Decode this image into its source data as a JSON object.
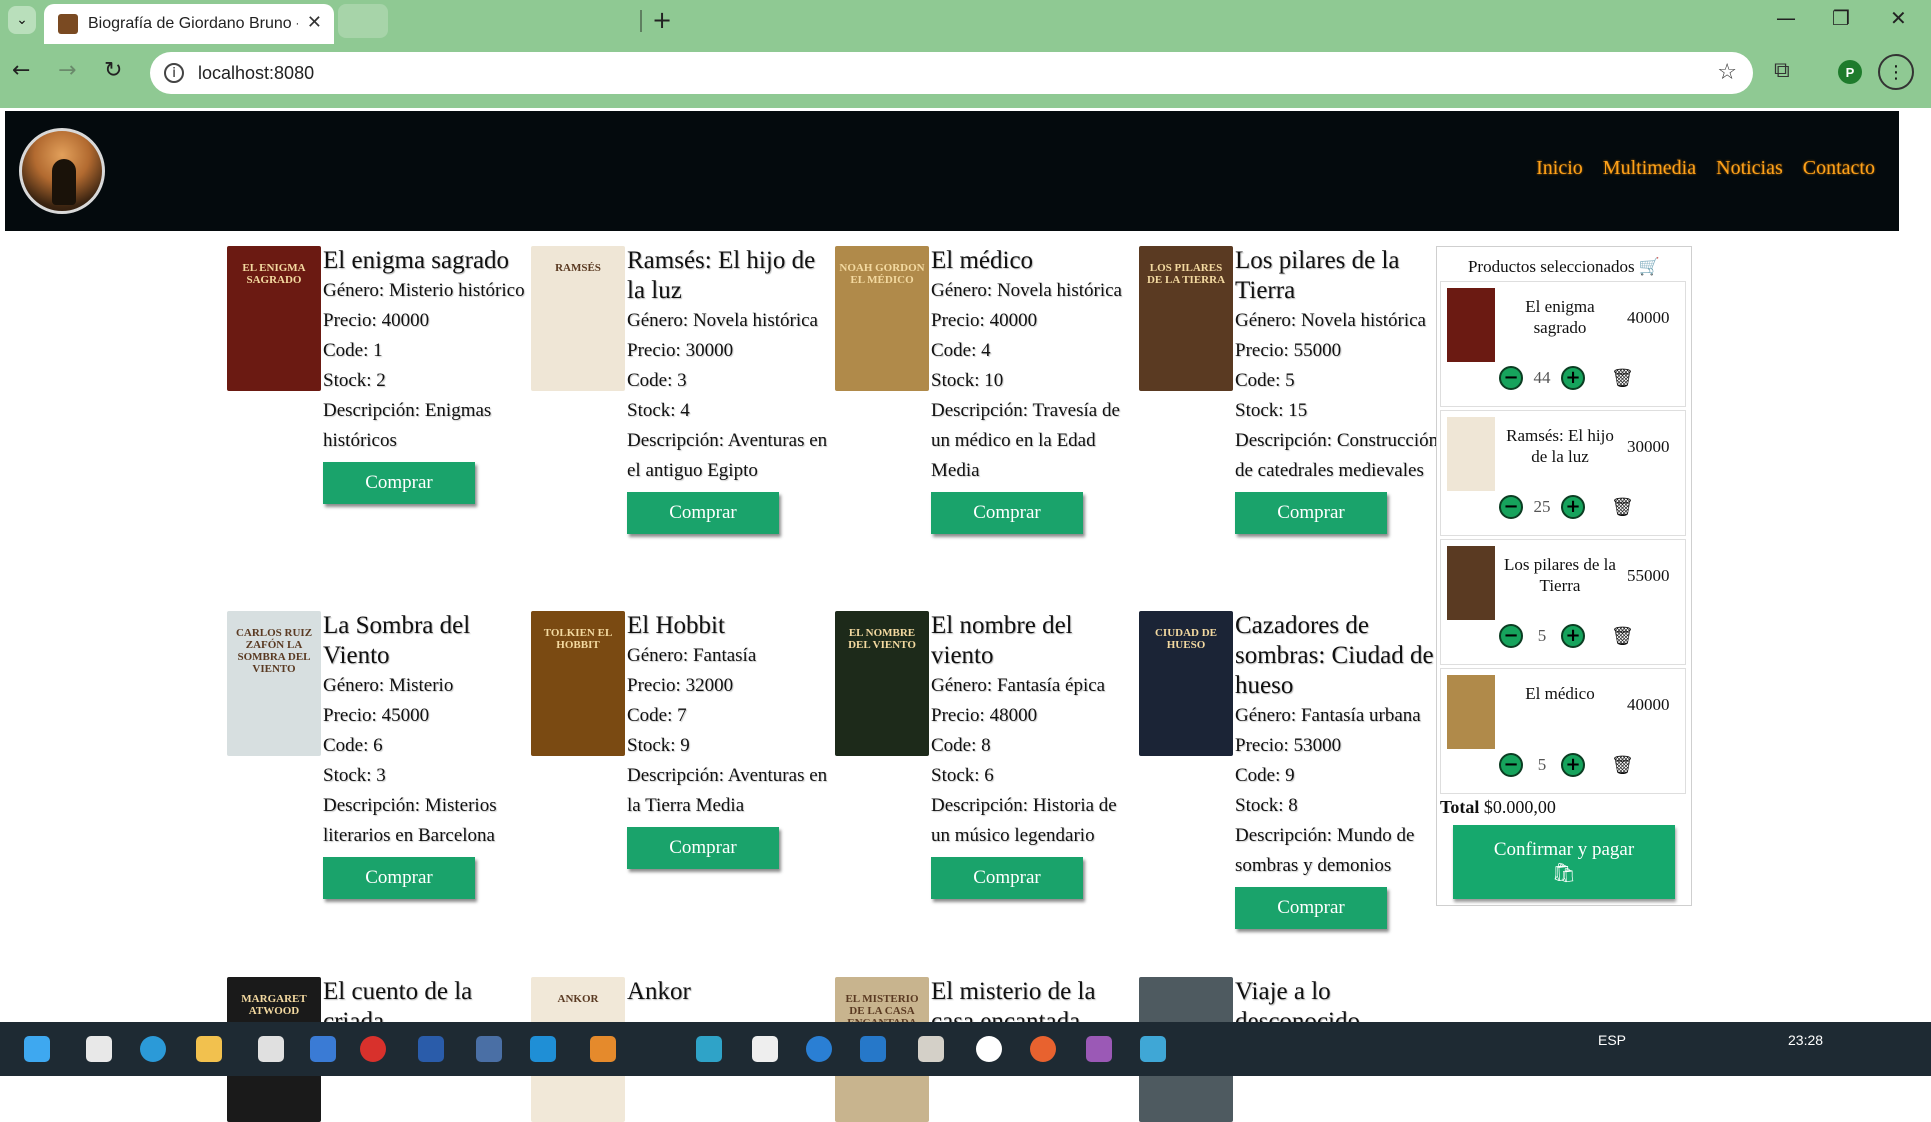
{
  "browser": {
    "tab_title": "Biografía de Giordano Bruno - V",
    "url": "localhost:8080",
    "profile_initial": "P"
  },
  "nav": [
    "Inicio",
    "Multimedia",
    "Noticias",
    "Contacto"
  ],
  "labels": {
    "genre": "Género: ",
    "price": "Precio: ",
    "code": "Code: ",
    "stock": "Stock: ",
    "desc": "Descripción: ",
    "buy": "Comprar"
  },
  "products": [
    {
      "name": "El enigma sagrado",
      "genre": "Misterio histórico",
      "price": "40000",
      "code": "1",
      "stock": "2",
      "desc": "Enigmas históricos",
      "cover_color": "#6b1a12",
      "cover_text": "EL ENIGMA SAGRADO"
    },
    {
      "name": "Ramsés: El hijo de la luz",
      "genre": "Novela histórica",
      "price": "30000",
      "code": "3",
      "stock": "4",
      "desc": "Aventuras en el antiguo Egipto",
      "cover_color": "#efe6d6",
      "cover_text": "RAMSÉS"
    },
    {
      "name": "El médico",
      "genre": "Novela histórica",
      "price": "40000",
      "code": "4",
      "stock": "10",
      "desc": "Travesía de un médico en la Edad Media",
      "cover_color": "#b08a4a",
      "cover_text": "NOAH GORDON EL MÉDICO"
    },
    {
      "name": "Los pilares de la Tierra",
      "genre": "Novela histórica",
      "price": "55000",
      "code": "5",
      "stock": "15",
      "desc": "Construcción de catedrales medievales",
      "cover_color": "#5a3a22",
      "cover_text": "LOS PILARES DE LA TIERRA"
    },
    {
      "name": "La Sombra del Viento",
      "genre": "Misterio",
      "price": "45000",
      "code": "6",
      "stock": "3",
      "desc": "Misterios literarios en Barcelona",
      "cover_color": "#d7dfe0",
      "cover_text": "CARLOS RUIZ ZAFÓN LA SOMBRA DEL VIENTO"
    },
    {
      "name": "El Hobbit",
      "genre": "Fantasía",
      "price": "32000",
      "code": "7",
      "stock": "9",
      "desc": "Aventuras en la Tierra Media",
      "cover_color": "#7a4a12",
      "cover_text": "TOLKIEN EL HOBBIT"
    },
    {
      "name": "El nombre del viento",
      "genre": "Fantasía épica",
      "price": "48000",
      "code": "8",
      "stock": "6",
      "desc": "Historia de un músico legendario",
      "cover_color": "#1d2a1a",
      "cover_text": "EL NOMBRE DEL VIENTO"
    },
    {
      "name": "Cazadores de sombras: Ciudad de hueso",
      "genre": "Fantasía urbana",
      "price": "53000",
      "code": "9",
      "stock": "8",
      "desc": "Mundo de sombras y demonios",
      "cover_color": "#1b2436",
      "cover_text": "CIUDAD DE HUESO"
    },
    {
      "name": "El cuento de la criada",
      "cover_color": "#1a1a1a",
      "cover_text": "MARGARET ATWOOD"
    },
    {
      "name": "Ankor",
      "cover_color": "#f1e8d8",
      "cover_text": "ANKOR"
    },
    {
      "name": "El misterio de la casa encantada",
      "cover_color": "#c8b48e",
      "cover_text": "EL MISTERIO DE LA CASA ENCANTADA"
    },
    {
      "name": "Viaje a lo desconocido",
      "cover_color": "#4e5a60",
      "cover_text": ""
    }
  ],
  "cart": {
    "title": "Productos seleccionados",
    "items": [
      {
        "name": "El enigma sagrado",
        "price": "40000",
        "qty": "44",
        "cover_color": "#6b1a12"
      },
      {
        "name": "Ramsés: El hijo de la luz",
        "price": "30000",
        "qty": "25",
        "cover_color": "#efe6d6"
      },
      {
        "name": "Los pilares de la Tierra",
        "price": "55000",
        "qty": "5",
        "cover_color": "#5a3a22"
      },
      {
        "name": "El médico",
        "price": "40000",
        "qty": "5",
        "cover_color": "#b08a4a"
      }
    ],
    "total_label": "Total",
    "total_value": "$0.000,00",
    "pay_label": "Confirmar y pagar"
  },
  "taskbar": {
    "lang": "ESP",
    "time": "23:28"
  }
}
